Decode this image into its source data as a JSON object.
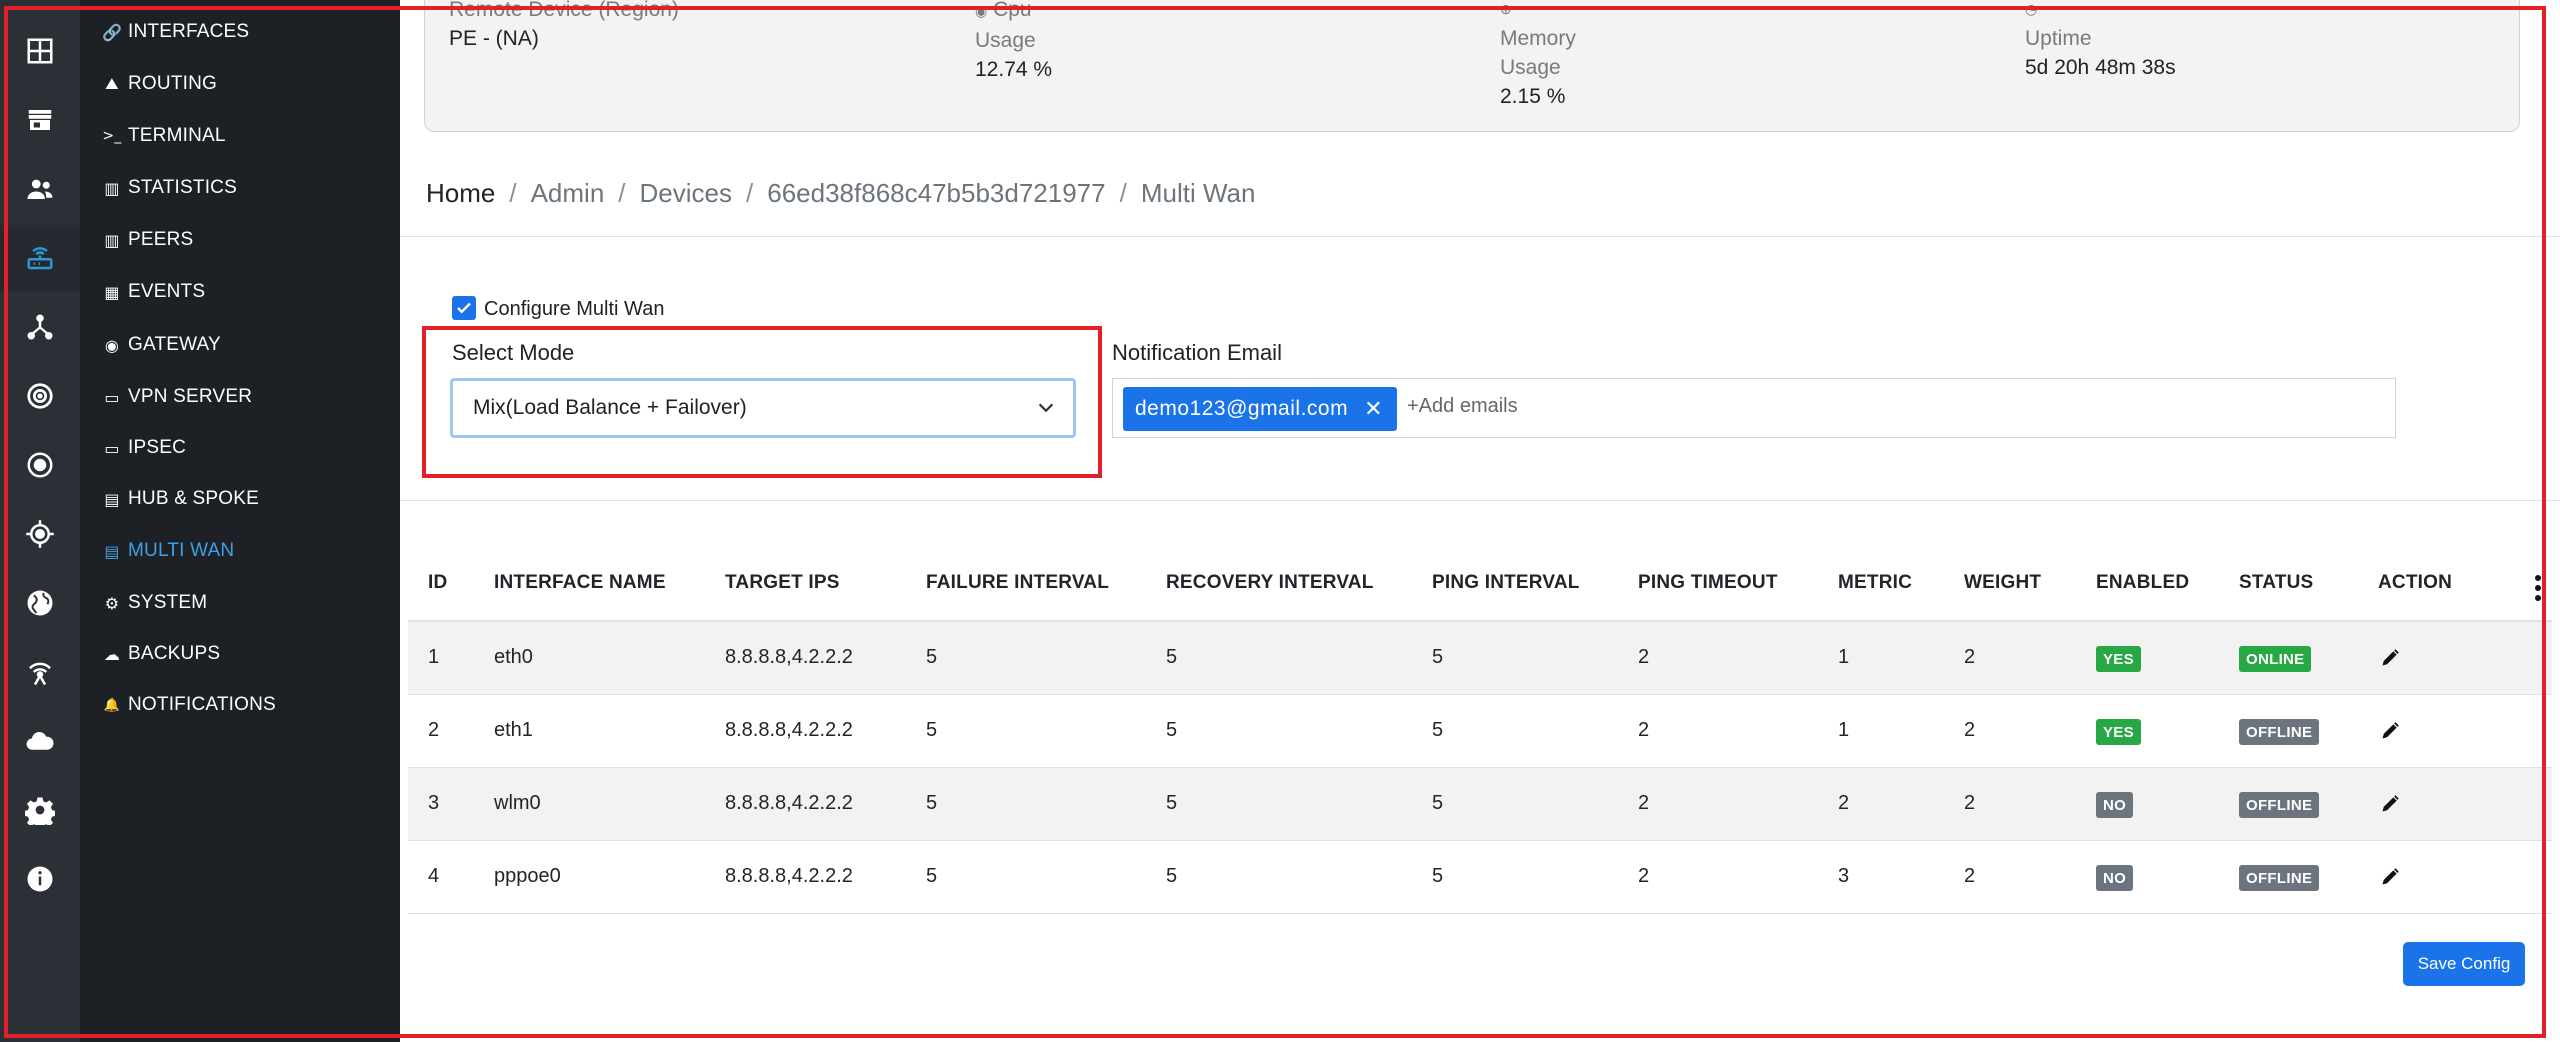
{
  "colors": {
    "accent": "#1a73e8",
    "highlight": "#e3202a",
    "rail": "#2b2f36",
    "subnav": "#1d2025",
    "active_nav": "#3fa0e6"
  },
  "rail": {
    "icons": [
      "dashboard-icon",
      "store-icon",
      "users-icon",
      "router-icon",
      "topology-icon",
      "radar-icon",
      "target-icon",
      "gps-icon",
      "globe-icon",
      "antenna-icon",
      "cloud-icon",
      "settings-icon",
      "info-icon"
    ]
  },
  "subnav": {
    "items": [
      {
        "label": "INTERFACES",
        "icon": "🔗"
      },
      {
        "label": "ROUTING",
        "icon": "⛰"
      },
      {
        "label": "TERMINAL",
        "icon": ">_"
      },
      {
        "label": "STATISTICS",
        "icon": "▥"
      },
      {
        "label": "PEERS",
        "icon": "▥"
      },
      {
        "label": "EVENTS",
        "icon": "▦"
      },
      {
        "label": "GATEWAY",
        "icon": "◉"
      },
      {
        "label": "VPN SERVER",
        "icon": "▭"
      },
      {
        "label": "IPSEC",
        "icon": "▭"
      },
      {
        "label": "HUB & SPOKE",
        "icon": "▤"
      },
      {
        "label": "MULTI WAN",
        "icon": "▤"
      },
      {
        "label": "SYSTEM",
        "icon": "⚙"
      },
      {
        "label": "BACKUPS",
        "icon": "☁"
      },
      {
        "label": "NOTIFICATIONS",
        "icon": "🔔"
      }
    ],
    "active": "MULTI WAN"
  },
  "device_info": {
    "region_label": "Remote Device (Region)",
    "region_value": "PE - (NA)",
    "cpu_label_1": "Cpu",
    "cpu_label_2": "Usage",
    "cpu_value": "12.74 %",
    "mem_label_1": "Memory",
    "mem_label_2": "Usage",
    "mem_value": "2.15 %",
    "uptime_label": "Uptime",
    "uptime_value": "5d 20h 48m 38s"
  },
  "breadcrumb": [
    "Home",
    "Admin",
    "Devices",
    "66ed38f868c47b5b3d721977",
    "Multi Wan"
  ],
  "config": {
    "checkbox_label": "Configure Multi Wan",
    "checked": true,
    "mode_label": "Select Mode",
    "mode_value": "Mix(Load Balance + Failover)",
    "email_label": "Notification Email",
    "email_chip": "demo123@gmail.com",
    "email_placeholder": "+Add emails"
  },
  "table": {
    "headers": [
      "ID",
      "INTERFACE NAME",
      "TARGET IPS",
      "FAILURE INTERVAL",
      "RECOVERY INTERVAL",
      "PING INTERVAL",
      "PING TIMEOUT",
      "METRIC",
      "WEIGHT",
      "ENABLED",
      "STATUS",
      "ACTION"
    ],
    "rows": [
      {
        "id": "1",
        "name": "eth0",
        "ips": "8.8.8.8,4.2.2.2",
        "fail": "5",
        "recov": "5",
        "ping": "5",
        "timeout": "2",
        "metric": "1",
        "weight": "2",
        "enabled": "YES",
        "status": "ONLINE"
      },
      {
        "id": "2",
        "name": "eth1",
        "ips": "8.8.8.8,4.2.2.2",
        "fail": "5",
        "recov": "5",
        "ping": "5",
        "timeout": "2",
        "metric": "1",
        "weight": "2",
        "enabled": "YES",
        "status": "OFFLINE"
      },
      {
        "id": "3",
        "name": "wlm0",
        "ips": "8.8.8.8,4.2.2.2",
        "fail": "5",
        "recov": "5",
        "ping": "5",
        "timeout": "2",
        "metric": "2",
        "weight": "2",
        "enabled": "NO",
        "status": "OFFLINE"
      },
      {
        "id": "4",
        "name": "pppoe0",
        "ips": "8.8.8.8,4.2.2.2",
        "fail": "5",
        "recov": "5",
        "ping": "5",
        "timeout": "2",
        "metric": "3",
        "weight": "2",
        "enabled": "NO",
        "status": "OFFLINE"
      }
    ]
  },
  "save_label": "Save Config"
}
